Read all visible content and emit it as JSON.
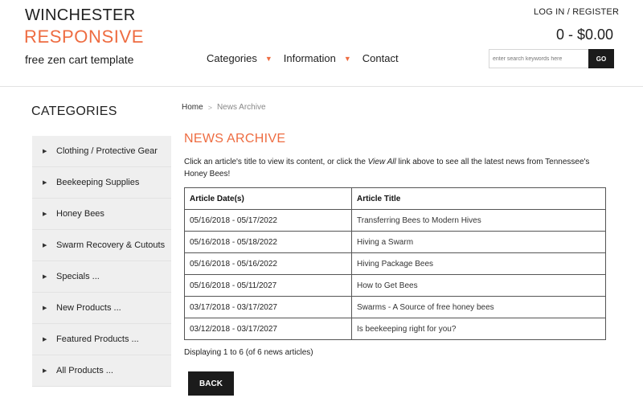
{
  "header": {
    "logo_line1": "WINCHESTER",
    "logo_line2": "RESPONSIVE",
    "logo_line3": "free zen cart template",
    "login_label": "LOG IN / REGISTER",
    "cart_total": "0 - $0.00",
    "search_placeholder": "enter search keywords here",
    "search_button": "GO",
    "nav": [
      {
        "label": "Categories",
        "caret": "▼"
      },
      {
        "label": "Information",
        "caret": "▼"
      },
      {
        "label": "Contact"
      }
    ]
  },
  "sidebar": {
    "heading": "CATEGORIES",
    "items": [
      {
        "label": "Clothing / Protective Gear"
      },
      {
        "label": "Beekeeping Supplies"
      },
      {
        "label": "Honey Bees"
      },
      {
        "label": "Swarm Recovery & Cutouts"
      },
      {
        "label": "Specials ..."
      },
      {
        "label": "New Products ..."
      },
      {
        "label": "Featured Products ..."
      },
      {
        "label": "All Products ..."
      }
    ]
  },
  "breadcrumb": {
    "home": "Home",
    "separator": ">",
    "current": "News Archive"
  },
  "main": {
    "title": "NEWS ARCHIVE",
    "intro_before": "Click an article's title to view its content, or click the ",
    "intro_link": "View All",
    "intro_after": " link above to see all the latest news from Tennessee's Honey Bees!",
    "table": {
      "headers": [
        "Article Date(s)",
        "Article Title"
      ],
      "rows": [
        {
          "date": "05/16/2018 - 05/17/2022",
          "title": "Transferring Bees to Modern Hives"
        },
        {
          "date": "05/16/2018 - 05/18/2022",
          "title": "Hiving a Swarm"
        },
        {
          "date": "05/16/2018 - 05/16/2022",
          "title": "Hiving Package Bees"
        },
        {
          "date": "05/16/2018 - 05/11/2027",
          "title": "How to Get Bees"
        },
        {
          "date": "03/17/2018 - 03/17/2027",
          "title": "Swarms - A Source of free honey bees"
        },
        {
          "date": "03/12/2018 - 03/17/2027",
          "title": "Is beekeeping right for you?"
        }
      ]
    },
    "displaying": "Displaying 1 to 6 (of 6 news articles)",
    "back_button": "BACK"
  },
  "colors": {
    "accent": "#ee6c41",
    "button_bg": "#1b1b1b",
    "sidebar_bg": "#efefef"
  },
  "icons": {
    "nav_caret": "caret-down-icon",
    "sidebar_arrow": "caret-right-icon",
    "breadcrumb_separator": "chevron-right-icon"
  }
}
